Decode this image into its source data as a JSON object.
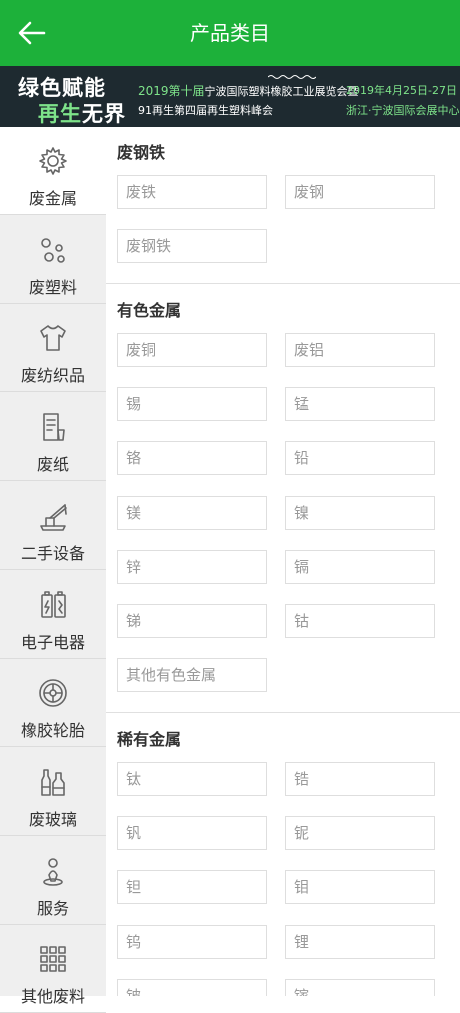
{
  "header": {
    "title": "产品类目"
  },
  "banner": {
    "slogan_part1": "绿色赋能",
    "slogan_part2a": "再生",
    "slogan_part2b": "无界",
    "event_year": "2019第十届",
    "event_line1": "宁波国际塑料橡胶工业展览会暨",
    "event_line2": "91再生第四届再生塑料峰会",
    "date": "2019年4月25日-27日",
    "venue": "浙江·宁波国际会展中心"
  },
  "sidebar": {
    "items": [
      {
        "label": "废金属",
        "icon": "gear-icon"
      },
      {
        "label": "废塑料",
        "icon": "pellets-icon"
      },
      {
        "label": "废纺织品",
        "icon": "tshirt-icon"
      },
      {
        "label": "废纸",
        "icon": "paper-icon"
      },
      {
        "label": "二手设备",
        "icon": "crane-icon"
      },
      {
        "label": "电子电器",
        "icon": "battery-icon"
      },
      {
        "label": "橡胶轮胎",
        "icon": "tire-icon"
      },
      {
        "label": "废玻璃",
        "icon": "bottle-icon"
      },
      {
        "label": "服务",
        "icon": "service-icon"
      },
      {
        "label": "其他废料",
        "icon": "grid-icon"
      }
    ],
    "active_index": 0
  },
  "sections": [
    {
      "title": "废钢铁",
      "items": [
        "废铁",
        "废钢",
        "废钢铁"
      ]
    },
    {
      "title": "有色金属",
      "items": [
        "废铜",
        "废铝",
        "锡",
        "锰",
        "铬",
        "铅",
        "镁",
        "镍",
        "锌",
        "镉",
        "锑",
        "钴",
        "其他有色金属"
      ]
    },
    {
      "title": "稀有金属",
      "items": [
        "钛",
        "锆",
        "钒",
        "铌",
        "钽",
        "钼",
        "钨",
        "锂",
        "铍",
        "镓"
      ]
    }
  ],
  "colors": {
    "brand_green": "#1db13a",
    "banner_bg": "#1e2a30",
    "accent_green": "#7ee38a"
  }
}
